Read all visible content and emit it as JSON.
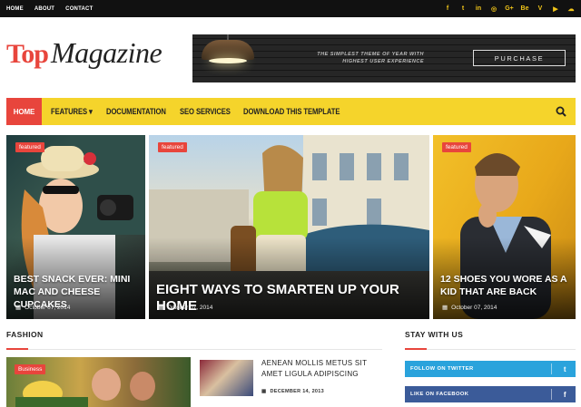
{
  "topbar": {
    "links": [
      "HOME",
      "ABOUT",
      "CONTACT"
    ],
    "social_icons": [
      "facebook-icon",
      "twitter-icon",
      "linkedin-icon",
      "instagram-icon",
      "googleplus-icon",
      "behance-icon",
      "vimeo-icon",
      "youtube-icon",
      "soundcloud-icon"
    ],
    "social_glyphs": [
      "f",
      "t",
      "in",
      "◎",
      "G+",
      "Be",
      "V",
      "▶",
      "☁"
    ]
  },
  "logo": {
    "part1": "Top",
    "part2": "Magazine"
  },
  "banner": {
    "slogan": "THE SIMPLEST THEME OF YEAR WITH HIGHEST USER EXPERIENCE",
    "button": "PURCHASE"
  },
  "nav": {
    "items": [
      "HOME",
      "FEATURES ▾",
      "DOCUMENTATION",
      "SEO SERVICES",
      "DOWNLOAD THIS TEMPLATE"
    ],
    "search_icon": "search-icon"
  },
  "featured": [
    {
      "label": "featured",
      "title": "BEST SNACK EVER: MINI MAC AND CHEESE CUPCAKES",
      "date": "October 07, 2014"
    },
    {
      "label": "featured",
      "title": "EIGHT WAYS TO SMARTEN UP YOUR HOME",
      "date": "October 07, 2014"
    },
    {
      "label": "featured",
      "title": "12 SHOES YOU WORE AS A KID THAT ARE BACK",
      "date": "October 07, 2014"
    }
  ],
  "fashion": {
    "heading": "FASHION",
    "main_label": "Business",
    "post": {
      "title": "AENEAN MOLLIS METUS SIT AMET LIGULA ADIPISCING",
      "date": "DECEMBER 14, 2013"
    }
  },
  "stay": {
    "heading": "STAY WITH US",
    "twitter": "FOLLOW ON TWITTER",
    "facebook": "LIKE ON FACEBOOK"
  },
  "colors": {
    "accent": "#e8453c",
    "nav": "#f5d42b",
    "twitter": "#2aa3dc",
    "facebook": "#3b5b99"
  }
}
